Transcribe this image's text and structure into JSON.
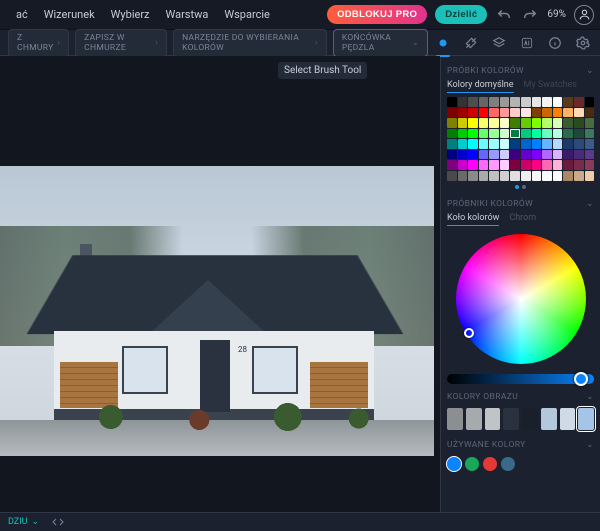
{
  "menu": {
    "items": [
      "ać",
      "Wizerunek",
      "Wybierz",
      "Warstwa",
      "Wsparcie"
    ]
  },
  "header": {
    "unlock": "ODBLOKUJ PRO",
    "share": "Dzielić",
    "zoom": "69%"
  },
  "subbar": {
    "chips": [
      "Z CHMURY",
      "ZAPISZ W CHMURZE",
      "NARZĘDZIE DO WYBIERANIA KOLORÓW",
      "KOŃCÓWKA PĘDZLA"
    ]
  },
  "tooltip": "Select Brush Tool",
  "house_number": "28",
  "panel": {
    "swatches_title": "PRÓBKI KOLORÓW",
    "swatches_tab_default": "Kolory domyślne",
    "swatches_tab_mine": "My Swatches",
    "pickers_title": "PRÓBNIKI KOLORÓW",
    "picker_tab_wheel": "Koło kolorów",
    "picker_tab_chrome": "Chrom",
    "image_colors_title": "KOLORY OBRAZU",
    "used_colors_title": "UŻYWANE KOLORY"
  },
  "swatches": [
    "#000000",
    "#333333",
    "#4d4d4d",
    "#666666",
    "#7f7f7f",
    "#999999",
    "#b3b3b3",
    "#cccccc",
    "#e5e5e5",
    "#f2f2f2",
    "#ffffff",
    "#5a3a1e",
    "#6b2a2a",
    "#000000",
    "#7f0000",
    "#a00000",
    "#cc0000",
    "#ff0000",
    "#ff6666",
    "#ff9999",
    "#ffcccc",
    "#ffe5e5",
    "#7f3f00",
    "#cc6600",
    "#ff8000",
    "#ffb366",
    "#ffd9b3",
    "#4a2a10",
    "#7f7f00",
    "#cccc00",
    "#ffff00",
    "#ffff66",
    "#ffff99",
    "#ffffcc",
    "#3f7f00",
    "#66cc00",
    "#80ff00",
    "#b3ff66",
    "#d9ffb3",
    "#3a5a2f",
    "#2a4a1f",
    "#4a6a3f",
    "#007f00",
    "#00cc00",
    "#00ff00",
    "#66ff66",
    "#99ff99",
    "#ccffcc",
    "#007f3f",
    "#00cc7f",
    "#00ff9f",
    "#66ffc2",
    "#b3ffe0",
    "#2a6a4a",
    "#1a4a3a",
    "#3a7a5a",
    "#007f7f",
    "#00cccc",
    "#00ffff",
    "#66ffff",
    "#99ffff",
    "#ccffff",
    "#003f7f",
    "#0066cc",
    "#0080ff",
    "#66b3ff",
    "#b3d9ff",
    "#1a3a6a",
    "#2a4a7a",
    "#3a5a8a",
    "#00007f",
    "#0000cc",
    "#0000ff",
    "#6666ff",
    "#9999ff",
    "#ccccff",
    "#3f007f",
    "#6600cc",
    "#8000ff",
    "#b366ff",
    "#d9b3ff",
    "#3a1a6a",
    "#4a2a7a",
    "#5a3a8a",
    "#7f007f",
    "#cc00cc",
    "#ff00ff",
    "#ff66ff",
    "#ff99ff",
    "#ffccff",
    "#7f003f",
    "#cc0066",
    "#ff0080",
    "#ff66b3",
    "#ffb3d9",
    "#6a1a3a",
    "#7a2a4a",
    "#8a3a5a",
    "#4a4a4a",
    "#6a6a6a",
    "#8a8a8a",
    "#aaaaaa",
    "#c0c0c0",
    "#d0d0d0",
    "#e0e0e0",
    "#efefef",
    "#f7f7f7",
    "#fcfcfc",
    "#ffffff",
    "#aa8866",
    "#ccaa88",
    "#eeccaa"
  ],
  "selected_swatch_index": 48,
  "image_colors": [
    "#8b8f92",
    "#a6aaad",
    "#c0c4c7",
    "#2a3240",
    "#1a202a",
    "#b3c7dd",
    "#d0dae6",
    "#a4c5e8"
  ],
  "image_colors_selected": 7,
  "used_colors": [
    "#0a84ff",
    "#18a85a",
    "#e53935",
    "#3a6a8a"
  ],
  "used_colors_selected": 0,
  "bottom": {
    "label": "DZIU"
  }
}
